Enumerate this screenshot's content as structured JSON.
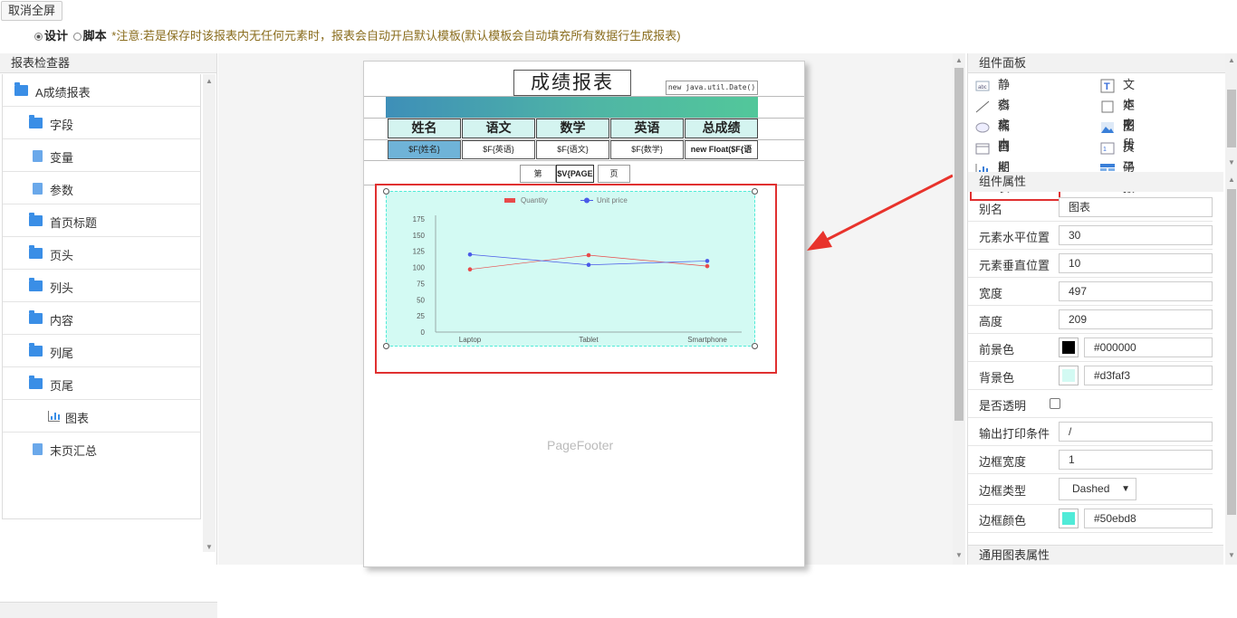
{
  "toolbar": {
    "exit_fullscreen": "取消全屏"
  },
  "mode": {
    "design": "设计",
    "script": "脚本",
    "notice": "*注意:若是保存时该报表内无任何元素时，报表会自动开启默认模板(默认模板会自动填充所有数据行生成报表)"
  },
  "inspector": {
    "title": "报表检查器",
    "items": [
      {
        "label": "A成绩报表",
        "icon": "folder-open-icon"
      },
      {
        "label": "字段",
        "icon": "folder-icon"
      },
      {
        "label": "变量",
        "icon": "document-icon"
      },
      {
        "label": "参数",
        "icon": "document-icon"
      },
      {
        "label": "首页标题",
        "icon": "folder-icon"
      },
      {
        "label": "页头",
        "icon": "folder-icon"
      },
      {
        "label": "列头",
        "icon": "folder-icon"
      },
      {
        "label": "内容",
        "icon": "folder-icon"
      },
      {
        "label": "列尾",
        "icon": "folder-icon"
      },
      {
        "label": "页尾",
        "icon": "folder-open-icon"
      },
      {
        "label": "图表",
        "icon": "chart-icon"
      },
      {
        "label": "末页汇总",
        "icon": "document-icon"
      }
    ]
  },
  "report": {
    "title": "成绩报表",
    "date_field": "new java.util.Date()",
    "headers": [
      "姓名",
      "语文",
      "数学",
      "英语",
      "总成绩"
    ],
    "fields": [
      "$F{姓名}",
      "$F{英语}",
      "$F{语文}",
      "$F{数学}",
      "new Float($F{语"
    ],
    "page_prefix": "第",
    "page_var": "$V{PAGE",
    "page_suffix": "页",
    "footer_label": "PageFooter"
  },
  "chart_data": {
    "type": "line",
    "categories": [
      "Laptop",
      "Tablet",
      "Smartphone"
    ],
    "series": [
      {
        "name": "Quantity",
        "values": [
          97,
          119,
          102
        ],
        "color": "#e84a4a"
      },
      {
        "name": "Unit price",
        "values": [
          120,
          104,
          110
        ],
        "color": "#4a5ae8"
      }
    ],
    "ylim": [
      0,
      175
    ],
    "yticks": [
      "175",
      "150",
      "125",
      "100",
      "75",
      "50",
      "25",
      "0"
    ],
    "legend": "top"
  },
  "components": {
    "title": "组件面板",
    "items": [
      {
        "label": "静态文本",
        "icon": "static-text-icon"
      },
      {
        "label": "文本字段",
        "icon": "text-field-icon"
      },
      {
        "label": "斜线",
        "icon": "line-icon"
      },
      {
        "label": "矩形",
        "icon": "rectangle-icon"
      },
      {
        "label": "椭圆",
        "icon": "ellipse-icon"
      },
      {
        "label": "图片",
        "icon": "image-icon"
      },
      {
        "label": "日期",
        "icon": "date-icon"
      },
      {
        "label": "页码",
        "icon": "page-number-icon"
      },
      {
        "label": "图表",
        "icon": "chart-icon"
      },
      {
        "label": "子报表",
        "icon": "subreport-icon"
      }
    ]
  },
  "properties": {
    "title": "组件属性",
    "alias_label": "别名",
    "alias_value": "图表",
    "x_label": "元素水平位置",
    "x_value": "30",
    "y_label": "元素垂直位置",
    "y_value": "10",
    "width_label": "宽度",
    "width_value": "497",
    "height_label": "高度",
    "height_value": "209",
    "fg_label": "前景色",
    "fg_value": "#000000",
    "bg_label": "背景色",
    "bg_value": "#d3faf3",
    "transparent_label": "是否透明",
    "print_label": "输出打印条件",
    "print_value": "/",
    "border_width_label": "边框宽度",
    "border_width_value": "1",
    "border_type_label": "边框类型",
    "border_type_value": "Dashed",
    "border_color_label": "边框颜色",
    "border_color_value": "#50ebd8",
    "general_title": "通用图表属性"
  }
}
